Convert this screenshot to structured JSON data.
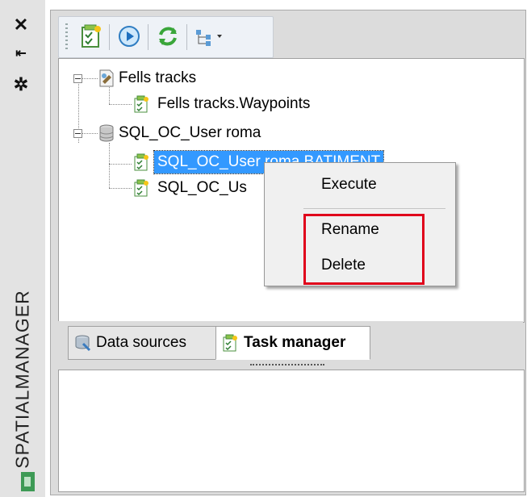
{
  "side_strip": {
    "title": "SPATIALMANAGER",
    "icons": [
      "close-icon",
      "pin-icon",
      "settings-icon"
    ]
  },
  "toolbar": {
    "buttons": [
      "new-task-icon",
      "run-icon",
      "refresh-icon",
      "tree-view-dropdown-icon"
    ]
  },
  "tree": {
    "nodes": [
      {
        "label": "Fells tracks",
        "icon": "datasource-file-icon"
      },
      {
        "label": "Fells tracks.Waypoints",
        "icon": "task-icon"
      },
      {
        "label": "SQL_OC_User roma",
        "icon": "database-icon"
      },
      {
        "label": "SQL_OC_User roma.BATIMENT",
        "icon": "task-icon",
        "selected": true
      },
      {
        "label": "SQL_OC_Us",
        "icon": "task-icon"
      }
    ]
  },
  "context_menu": {
    "items": [
      "Execute",
      "Rename",
      "Delete"
    ]
  },
  "tabs": [
    {
      "label": "Data sources",
      "icon": "data-sources-icon",
      "active": false
    },
    {
      "label": "Task manager",
      "icon": "task-manager-icon",
      "active": true
    }
  ],
  "colors": {
    "selection": "#3399ff",
    "highlight_box": "#e0001b",
    "panel_bg": "#dcdcdc"
  }
}
